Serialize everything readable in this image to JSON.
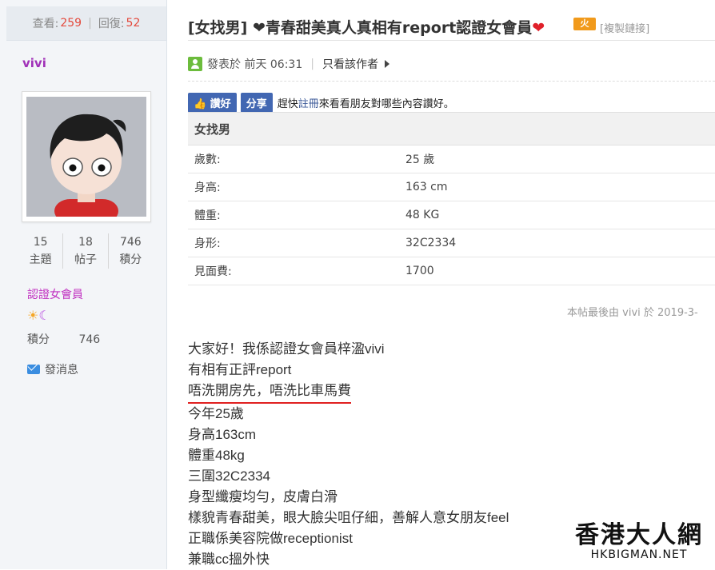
{
  "sidebar": {
    "views_label": "查看:",
    "views": "259",
    "replies_label": "回復:",
    "replies": "52",
    "username": "vivi",
    "stats": [
      {
        "value": "15",
        "label": "主題"
      },
      {
        "value": "18",
        "label": "帖子"
      },
      {
        "value": "746",
        "label": "積分"
      }
    ],
    "role": "認證女會員",
    "badge_icons": [
      "sun-icon",
      "moon-icon"
    ],
    "points_label": "積分",
    "points_value": "746",
    "message_label": "發消息"
  },
  "thread": {
    "title_prefix": "[女找男]",
    "title_main": "青春甜美真人真相有report認證女會員",
    "hot_badge": "火",
    "copy_link": "[複製鏈接]",
    "posted_label": "發表於",
    "posted_time": "前天 06:31",
    "only_author": "只看該作者"
  },
  "fb": {
    "like": "讚好",
    "share": "分享",
    "prompt_before": "趕快",
    "register": "註冊",
    "prompt_after": "來看看朋友對哪些內容讚好。"
  },
  "info_table": {
    "header": "女找男",
    "rows": [
      {
        "label": "歲數:",
        "value": "25 歲"
      },
      {
        "label": "身高:",
        "value": "163 cm"
      },
      {
        "label": "體重:",
        "value": "48 KG"
      },
      {
        "label": "身形:",
        "value": "32C2334"
      },
      {
        "label": "見面費:",
        "value": "1700"
      }
    ]
  },
  "last_edit": "本帖最後由 vivi 於 2019-3-",
  "body_lines": [
    "大家好！我係認證女會員梓溋vivi",
    "有相有正評report",
    "唔洗開房先，唔洗比車馬費",
    "今年25歲",
    "身高163cm",
    "體重48kg",
    "三圍32C2334",
    "身型纖瘦均勻，皮膚白滑",
    "樣貌青春甜美，眼大臉尖咀仔細，善解人意女朋友feel",
    "正職係美容院做receptionist",
    "兼職cc搵外快"
  ],
  "watermark": {
    "cn": "香港大人網",
    "en": "HKBIGMAN.NET"
  },
  "colors": {
    "accent_purple": "#a030b8",
    "count_red": "#e4493c",
    "facebook_blue": "#4267b2",
    "underline_red": "#e02020"
  }
}
